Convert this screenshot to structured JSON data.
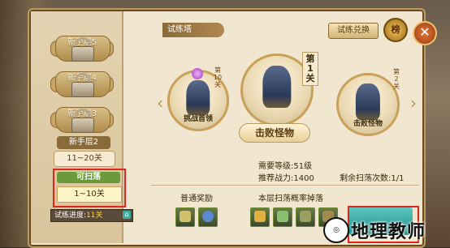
{
  "header": {
    "title": "试练塔",
    "exchange_label": "试练兑换",
    "rank_label": "榜",
    "close_label": "✕"
  },
  "levels": [
    {
      "label": "新手层5",
      "locked": true
    },
    {
      "label": "新手层4",
      "locked": true
    },
    {
      "label": "新手层3",
      "locked": true
    }
  ],
  "stage": {
    "name": "新手层2",
    "range": "11~20关"
  },
  "current": {
    "status": "可扫荡",
    "range": "1~10关"
  },
  "progress": {
    "label": "试练进度:",
    "value": "11关"
  },
  "monsters": {
    "left": {
      "caption": "挑战首领",
      "floor": "第10关"
    },
    "center": {
      "floor": "第1关"
    },
    "right": {
      "caption": "击败怪物",
      "floor": "第2关"
    }
  },
  "defeat_label": "击败怪物",
  "requirements": {
    "level": "需要等级:51级",
    "power": "推荐战力:1400",
    "sweeps": "剩余扫荡次数:1/1"
  },
  "rewards": {
    "normal_title": "普通奖励",
    "drop_title": "本层扫荡概率掉落"
  },
  "watermark": {
    "text": "地理教师"
  }
}
